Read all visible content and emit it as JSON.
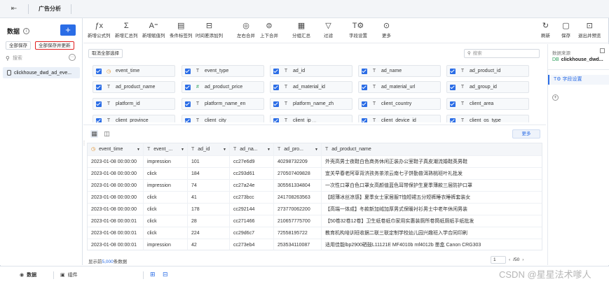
{
  "topbar": {
    "app_tab": "广告分析"
  },
  "left": {
    "title": "数据",
    "save_all": "全部保存",
    "save_all_update": "全部保存并更新",
    "search_placeholder": "搜索",
    "dataset": "clickhouse_dwd_ad_eve..."
  },
  "toolbar": {
    "tools": [
      {
        "name": "new-formula-column",
        "icon": "ƒx",
        "label": "新增公式列"
      },
      {
        "name": "new-summary-column",
        "icon": "Σ",
        "label": "新增汇总列"
      },
      {
        "name": "new-assign-column",
        "icon": "A⁼",
        "label": "新增赋值列"
      },
      {
        "name": "condition-tag-column",
        "icon": "▤",
        "label": "条件标签列"
      },
      {
        "name": "time-diff-column",
        "icon": "⊟",
        "label": "时间差添加列"
      },
      {
        "name": "left-right-merge",
        "icon": "◎",
        "label": "左右合并"
      },
      {
        "name": "up-down-merge",
        "icon": "⊜",
        "label": "上下合并"
      },
      {
        "name": "group-summary",
        "icon": "▦",
        "label": "分组汇总"
      },
      {
        "name": "filter",
        "icon": "▽",
        "label": "过滤"
      },
      {
        "name": "field-settings",
        "icon": "T⚙",
        "label": "字段设置"
      },
      {
        "name": "more",
        "icon": "⊙",
        "label": "更多"
      }
    ],
    "refresh": {
      "icon": "↻",
      "label": "刷新"
    },
    "save": {
      "icon": "▢",
      "label": "保存"
    },
    "exit_preview": {
      "icon": "⊡",
      "label": "退出并预览"
    }
  },
  "fields": {
    "cancel_all": "取消全部选择",
    "search_placeholder": "搜索",
    "items": [
      {
        "name": "event_time",
        "type": "clock"
      },
      {
        "name": "event_type",
        "type": "T"
      },
      {
        "name": "ad_id",
        "type": "T"
      },
      {
        "name": "ad_name",
        "type": "T"
      },
      {
        "name": "ad_product_id",
        "type": "T"
      },
      {
        "name": "ad_product_name",
        "type": "T"
      },
      {
        "name": "ad_product_price",
        "type": "#"
      },
      {
        "name": "ad_material_id",
        "type": "T"
      },
      {
        "name": "ad_material_url",
        "type": "T"
      },
      {
        "name": "ad_group_id",
        "type": "T"
      },
      {
        "name": "platform_id",
        "type": "T"
      },
      {
        "name": "platform_name_en",
        "type": "T"
      },
      {
        "name": "platform_name_zh",
        "type": "T"
      },
      {
        "name": "client_country",
        "type": "T"
      },
      {
        "name": "client_area",
        "type": "T"
      },
      {
        "name": "client_province",
        "type": "T"
      },
      {
        "name": "client_city",
        "type": "T"
      },
      {
        "name": "client_ip",
        "type": "T"
      },
      {
        "name": "client_device_id",
        "type": "T"
      },
      {
        "name": "client_os_type",
        "type": "T"
      }
    ]
  },
  "right": {
    "source_title": "数据来源",
    "source_name": "clickhouse_dwd...",
    "field_settings": "字段设置"
  },
  "preview": {
    "more_button": "更多",
    "columns": [
      {
        "label": "event_time",
        "type": "clock"
      },
      {
        "label": "event_...",
        "type": "T"
      },
      {
        "label": "ad_id",
        "type": "T"
      },
      {
        "label": "ad_na...",
        "type": "T"
      },
      {
        "label": "ad_pro...",
        "type": "T"
      },
      {
        "label": "ad_product_name",
        "type": "T"
      }
    ],
    "rows": [
      [
        "2023-01-08 00:00:00",
        "impression",
        "101",
        "cc27e6d9",
        "40298732209",
        "外壳高男士夜鞋白色商务休闲正装办公室鞋子真皮潮流婚鞋英男鞋"
      ],
      [
        "2023-01-08 00:00:00",
        "click",
        "184",
        "cc293d61",
        "270507409828",
        "宜关早春老阿草背济孩务茶浓云南七子饼勤普洱熟桃班叶礼批发"
      ],
      [
        "2023-01-08 00:00:00",
        "impression",
        "74",
        "cc27a24e",
        "305561334804",
        "一次性口罩白色口罩女高颜值蓝色耳带保护生夏季薄款三层防护口罩"
      ],
      [
        "2023-01-08 00:00:00",
        "click",
        "41",
        "cc273bcc",
        "241708263563",
        "【超薄冰丝凉感】夏季女士家居服T恤短裙五分短裤睡衣睡裤套装女"
      ],
      [
        "2023-01-08 00:00:00",
        "click",
        "178",
        "cc292144",
        "273770062200",
        "【高端一体成】冬款新加绒加厚男式保暖衬衫男士中老年休闲男装"
      ],
      [
        "2023-01-08 00:00:01",
        "click",
        "28",
        "cc271466",
        "210657775700",
        "【50卷32卷12卷】卫生纸卷纸巾家用实惠装厕所卷筒纸厕纸手纸批发"
      ],
      [
        "2023-01-08 00:00:01",
        "click",
        "224",
        "cc29d6c7",
        "72558195722",
        "教育机构培训班收据二联三联定制学校幼儿园兴趣班入学合同印刷"
      ],
      [
        "2023-01-08 00:00:01",
        "impression",
        "42",
        "cc273eb4",
        "253534110087",
        "适用佳能lbp2900硒鼓L11121E MF4010b mf4012b 墨盒 Canon CRG303"
      ]
    ],
    "footer_prefix": "显示前",
    "footer_count": "5,000",
    "footer_suffix": "条数据",
    "page_value": "1",
    "page_total": "/50"
  },
  "bottom": {
    "tab_data": "数据",
    "tab_component": "组件"
  },
  "watermark": "CSDN @星星法术嗲人",
  "colors": {
    "accent": "#2b6de6",
    "highlight_border": "#e02020"
  }
}
